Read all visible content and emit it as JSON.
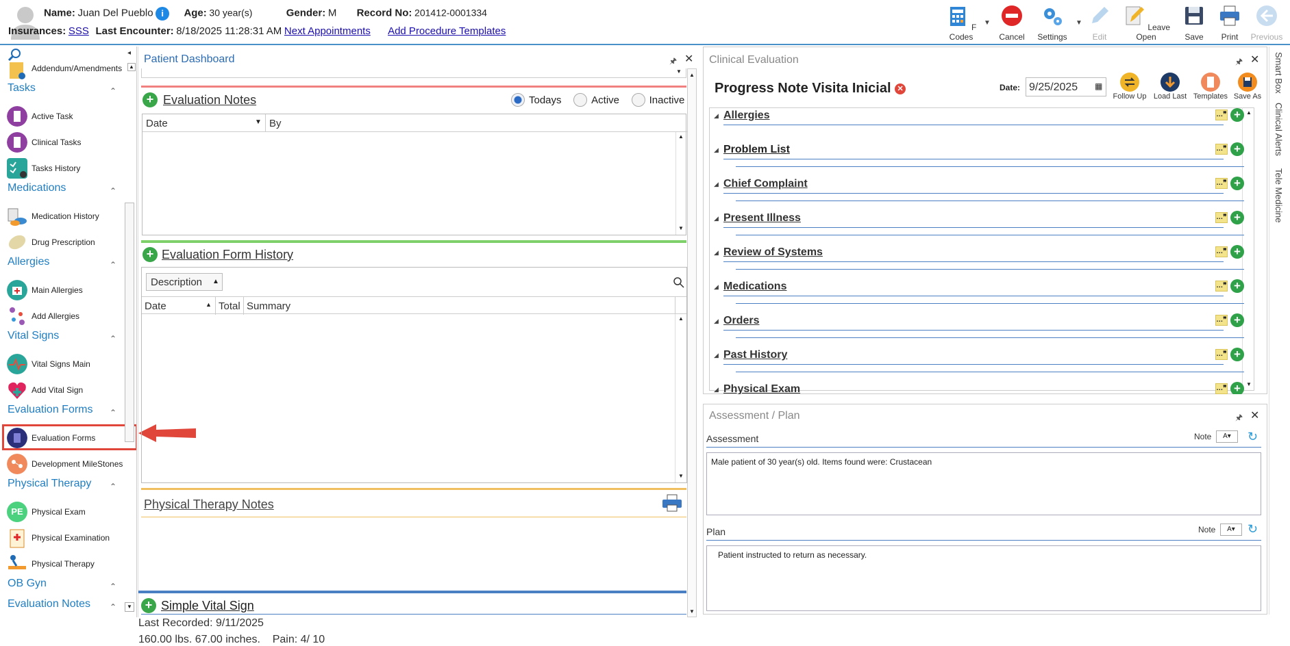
{
  "header": {
    "name_label": "Name:",
    "name": "Juan Del Pueblo",
    "info_icon": "i",
    "age_label": "Age:",
    "age": "30 year(s)",
    "gender_label": "Gender:",
    "gender": "M",
    "record_label": "Record No:",
    "record": "201412-0001334",
    "insurances_label": "Insurances:",
    "insurance": "SSS",
    "last_encounter_label": "Last Encounter:",
    "last_encounter": "8/18/2025 11:28:31 AM",
    "next_appointments": "Next Appointments",
    "add_procedure_templates": "Add Procedure Templates"
  },
  "toolbar": {
    "fcodes": "F Codes",
    "cancel": "Cancel",
    "settings": "Settings",
    "edit": "Edit",
    "leave_open": "Leave Open",
    "save": "Save",
    "print": "Print",
    "previous": "Previous"
  },
  "sidebar": {
    "collapse_icon": "◂",
    "addendum": "Addendum/Amendments",
    "tasks_title": "Tasks",
    "active_task": "Active Task",
    "clinical_tasks": "Clinical Tasks",
    "tasks_history": "Tasks History",
    "medications_title": "Medications",
    "medication_history": "Medication History",
    "drug_prescription": "Drug Prescription",
    "allergies_title": "Allergies",
    "main_allergies": "Main Allergies",
    "add_allergies": "Add Allergies",
    "vital_signs_title": "Vital Signs",
    "vital_signs_main": "Vital Signs Main",
    "add_vital_sign": "Add Vital Sign",
    "evaluation_forms_title": "Evaluation Forms",
    "evaluation_forms": "Evaluation Forms",
    "development_milestones": "Development MileStones",
    "physical_therapy_title": "Physical Therapy",
    "pe_badge": "PE",
    "physical_exam": "Physical Exam",
    "physical_examination": "Physical Examination",
    "physical_therapy": "Physical Therapy",
    "ob_gyn_title": "OB Gyn",
    "evaluation_notes_title": "Evaluation Notes"
  },
  "dashboard": {
    "title": "Patient Dashboard",
    "evaluation_notes": "Evaluation Notes",
    "radio_todays": "Todays",
    "radio_active": "Active",
    "radio_inactive": "Inactive",
    "col_date": "Date",
    "col_by": "By",
    "evaluation_form_history": "Evaluation Form History",
    "description_filter": "Description",
    "col_total": "Total",
    "col_summary": "Summary",
    "physical_therapy_notes": "Physical Therapy Notes",
    "simple_vital_sign": "Simple Vital Sign",
    "last_recorded": "Last Recorded: 9/11/2025",
    "vitals_line": "160.00 lbs. 67.00 inches.    Pain: 4/ 10"
  },
  "clinical": {
    "title": "Clinical Evaluation",
    "note_title": "Progress Note Visita Inicial",
    "date_label": "Date:",
    "date_value": "9/25/2025",
    "follow_up": "Follow Up",
    "load_last": "Load Last",
    "templates": "Templates",
    "save_as": "Save As",
    "sections": [
      "Allergies",
      "Problem List",
      "Chief Complaint",
      "Present Illness",
      "Review of Systems",
      "Medications",
      "Orders",
      "Past History",
      "Physical Exam"
    ]
  },
  "side_tabs": {
    "smart_box": "Smart Box",
    "clinical_alerts": "Clinical Alerts",
    "tele_medicine": "Tele Medicine"
  },
  "assessment_plan": {
    "title": "Assessment / Plan",
    "assessment_label": "Assessment",
    "note_label": "Note",
    "assessment_text": "Male patient of 30 year(s) old. Items found were:  Crustacean",
    "plan_label": "Plan",
    "plan_text": "Patient instructed to return as necessary."
  },
  "colors": {
    "accent": "#1f7ec3",
    "highlight_box": "#e0463a",
    "plus_green": "#3aa64a"
  }
}
